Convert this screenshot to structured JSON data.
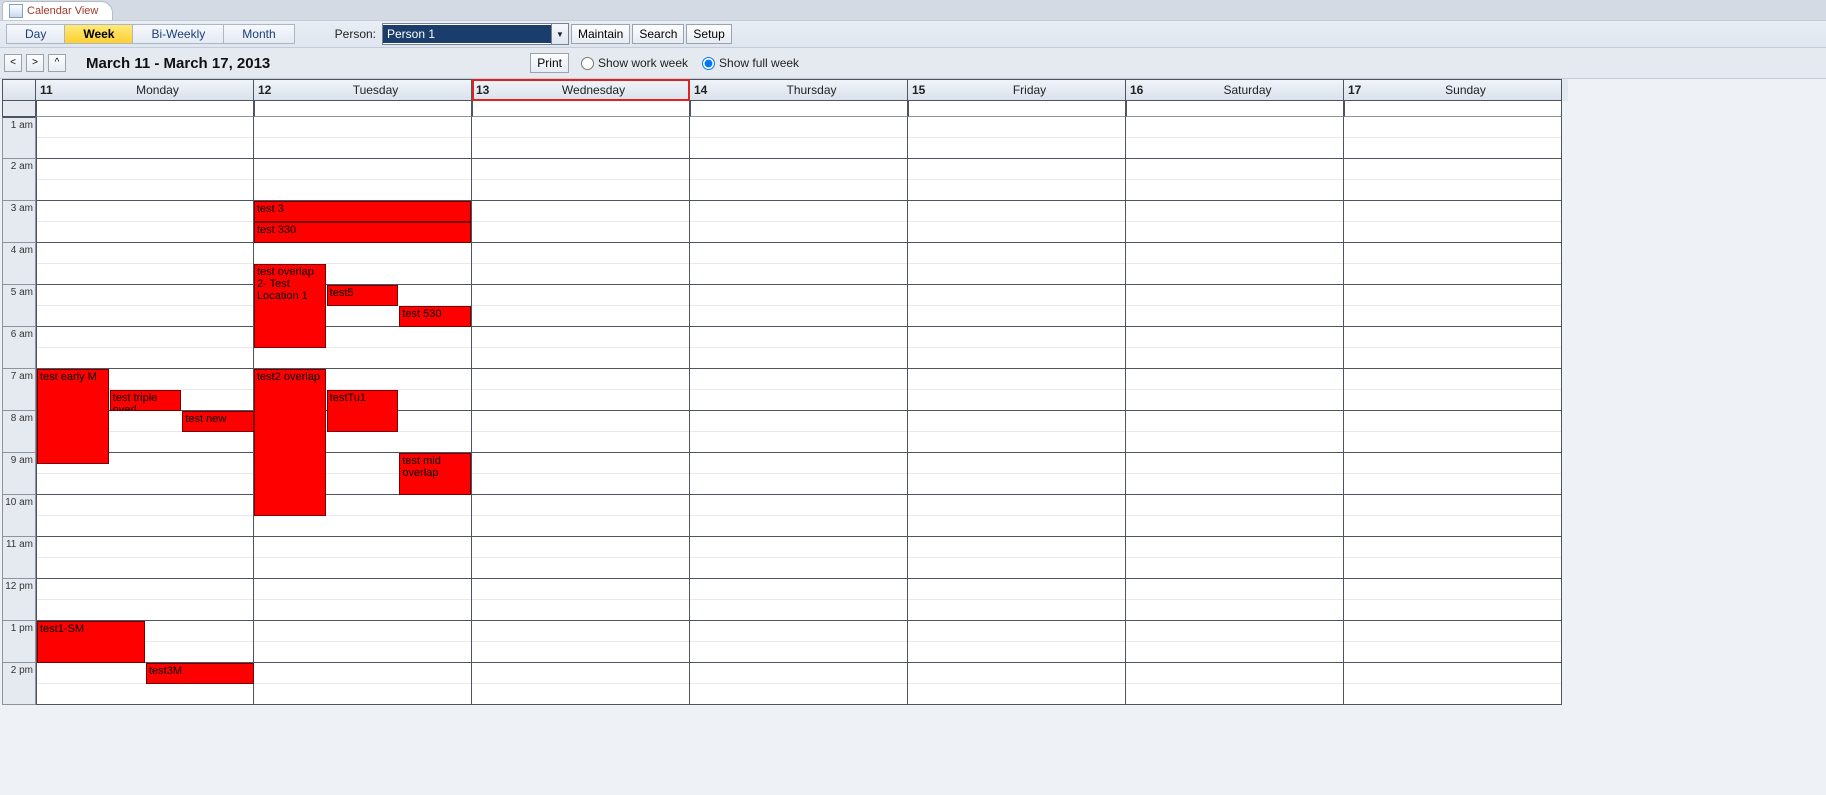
{
  "tab": {
    "title": "Calendar View"
  },
  "toolbar": {
    "views": {
      "day": "Day",
      "week": "Week",
      "biweekly": "Bi-Weekly",
      "month": "Month"
    },
    "selected_view": "week",
    "person_label": "Person:",
    "person_value": "Person 1",
    "maintain": "Maintain",
    "search": "Search",
    "setup": "Setup"
  },
  "subbar": {
    "range_title": "March 11 - March 17, 2013",
    "print": "Print",
    "show_work_week": "Show work week",
    "show_full_week": "Show full week",
    "week_mode": "full"
  },
  "hours": [
    "1  am",
    "2  am",
    "3  am",
    "4  am",
    "5  am",
    "6  am",
    "7  am",
    "8  am",
    "9  am",
    "10  am",
    "11  am",
    "12  pm",
    "1  pm",
    "2  pm"
  ],
  "days": [
    {
      "num": "11",
      "name": "Monday",
      "today": false
    },
    {
      "num": "12",
      "name": "Tuesday",
      "today": false
    },
    {
      "num": "13",
      "name": "Wednesday",
      "today": true
    },
    {
      "num": "14",
      "name": "Thursday",
      "today": false
    },
    {
      "num": "15",
      "name": "Friday",
      "today": false
    },
    {
      "num": "16",
      "name": "Saturday",
      "today": false
    },
    {
      "num": "17",
      "name": "Sunday",
      "today": false
    }
  ],
  "events": [
    {
      "day": 0,
      "label": "test early M",
      "start_hr": 7.0,
      "end_hr": 9.25,
      "col": 0,
      "cols": 3
    },
    {
      "day": 0,
      "label": "test triple overl",
      "start_hr": 7.5,
      "end_hr": 8.0,
      "col": 1,
      "cols": 3
    },
    {
      "day": 0,
      "label": "test new",
      "start_hr": 8.0,
      "end_hr": 8.5,
      "col": 2,
      "cols": 3
    },
    {
      "day": 0,
      "label": "test1-SM",
      "start_hr": 13.0,
      "end_hr": 14.0,
      "col": 0,
      "cols": 2
    },
    {
      "day": 0,
      "label": "test3M",
      "start_hr": 14.0,
      "end_hr": 14.5,
      "col": 1,
      "cols": 2
    },
    {
      "day": 1,
      "label": "test 3",
      "start_hr": 3.0,
      "end_hr": 3.5,
      "col": 0,
      "cols": 1
    },
    {
      "day": 1,
      "label": "test 330",
      "start_hr": 3.5,
      "end_hr": 4.0,
      "col": 0,
      "cols": 1
    },
    {
      "day": 1,
      "label": "test overlap 2- Test Location 1",
      "start_hr": 4.5,
      "end_hr": 6.5,
      "col": 0,
      "cols": 3
    },
    {
      "day": 1,
      "label": "test5",
      "start_hr": 5.0,
      "end_hr": 5.5,
      "col": 1,
      "cols": 3
    },
    {
      "day": 1,
      "label": "test 530",
      "start_hr": 5.5,
      "end_hr": 6.0,
      "col": 2,
      "cols": 3
    },
    {
      "day": 1,
      "label": "test2 overlap",
      "start_hr": 7.0,
      "end_hr": 10.5,
      "col": 0,
      "cols": 3
    },
    {
      "day": 1,
      "label": "testTu1",
      "start_hr": 7.5,
      "end_hr": 8.5,
      "col": 1,
      "cols": 3
    },
    {
      "day": 1,
      "label": "test mid overlap",
      "start_hr": 9.0,
      "end_hr": 10.0,
      "col": 2,
      "cols": 3
    }
  ]
}
